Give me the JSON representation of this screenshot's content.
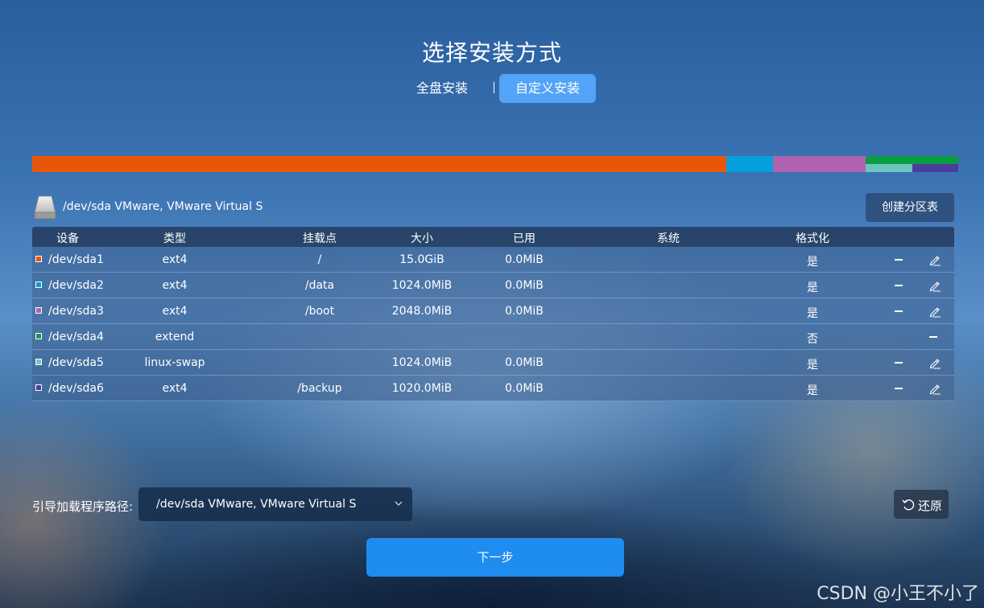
{
  "header": {
    "title": "选择安装方式"
  },
  "mode_tabs": {
    "full": "全盘安装",
    "custom": "自定义安装",
    "selected": "custom"
  },
  "disk_bar": {
    "segments": [
      {
        "partition": "/dev/sda1",
        "color": "#e8560a"
      },
      {
        "partition": "/dev/sda2",
        "color": "#069fdc"
      },
      {
        "partition": "/dev/sda3",
        "color": "#b162ae"
      },
      {
        "partition": "/dev/sda4",
        "color": "#0a9d45"
      },
      {
        "partition": "/dev/sda5",
        "color": "#6cc6bf"
      },
      {
        "partition": "/dev/sda6",
        "color": "#4a3d9c"
      }
    ]
  },
  "disk": {
    "label": "/dev/sda VMware, VMware Virtual S",
    "icon": "hard-disk-icon"
  },
  "create_partition_table_label": "创建分区表",
  "table": {
    "headers": {
      "device": "设备",
      "type": "类型",
      "mount": "挂载点",
      "size": "大小",
      "used": "已用",
      "system": "系统",
      "format": "格式化"
    },
    "rows": [
      {
        "device": "/dev/sda1",
        "color": "#e8560a",
        "type": "ext4",
        "mount": "/",
        "size": "15.0GiB",
        "used": "0.0MiB",
        "system": "",
        "format": "是",
        "editable": true
      },
      {
        "device": "/dev/sda2",
        "color": "#069fdc",
        "type": "ext4",
        "mount": "/data",
        "size": "1024.0MiB",
        "used": "0.0MiB",
        "system": "",
        "format": "是",
        "editable": true
      },
      {
        "device": "/dev/sda3",
        "color": "#b162ae",
        "type": "ext4",
        "mount": "/boot",
        "size": "2048.0MiB",
        "used": "0.0MiB",
        "system": "",
        "format": "是",
        "editable": true
      },
      {
        "device": "/dev/sda4",
        "color": "#0a9d45",
        "type": "extend",
        "mount": "",
        "size": "",
        "used": "",
        "system": "",
        "format": "否",
        "editable": false
      },
      {
        "device": "/dev/sda5",
        "color": "#6cc6bf",
        "type": "linux-swap",
        "mount": "",
        "size": "1024.0MiB",
        "used": "0.0MiB",
        "system": "",
        "format": "是",
        "editable": true
      },
      {
        "device": "/dev/sda6",
        "color": "#4a3d9c",
        "type": "ext4",
        "mount": "/backup",
        "size": "1020.0MiB",
        "used": "0.0MiB",
        "system": "",
        "format": "是",
        "editable": true
      }
    ]
  },
  "bootloader": {
    "label": "引导加载程序路径:",
    "value": "/dev/sda VMware, VMware Virtual S"
  },
  "restore_label": "还原",
  "next_label": "下一步",
  "watermark": "CSDN @小王不小了"
}
